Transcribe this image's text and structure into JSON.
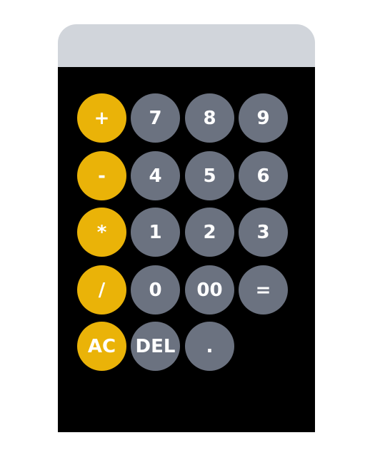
{
  "calculator": {
    "display": {
      "value": ""
    },
    "colors": {
      "display_bg": "#d1d5db",
      "keypad_bg": "#000000",
      "operator_button": "#eab308",
      "number_button": "#6b7280",
      "button_text": "#ffffff"
    },
    "rows": [
      [
        {
          "label": "+",
          "kind": "operator",
          "name": "plus-button"
        },
        {
          "label": "7",
          "kind": "number",
          "name": "seven-button"
        },
        {
          "label": "8",
          "kind": "number",
          "name": "eight-button"
        },
        {
          "label": "9",
          "kind": "number",
          "name": "nine-button"
        }
      ],
      [
        {
          "label": "-",
          "kind": "operator",
          "name": "minus-button"
        },
        {
          "label": "4",
          "kind": "number",
          "name": "four-button"
        },
        {
          "label": "5",
          "kind": "number",
          "name": "five-button"
        },
        {
          "label": "6",
          "kind": "number",
          "name": "six-button"
        }
      ],
      [
        {
          "label": "*",
          "kind": "operator",
          "name": "multiply-button"
        },
        {
          "label": "1",
          "kind": "number",
          "name": "one-button"
        },
        {
          "label": "2",
          "kind": "number",
          "name": "two-button"
        },
        {
          "label": "3",
          "kind": "number",
          "name": "three-button"
        }
      ],
      [
        {
          "label": "/",
          "kind": "operator",
          "name": "divide-button"
        },
        {
          "label": "0",
          "kind": "number",
          "name": "zero-button"
        },
        {
          "label": "00",
          "kind": "number",
          "name": "double-zero-button"
        },
        {
          "label": "=",
          "kind": "number",
          "name": "equals-button"
        }
      ],
      [
        {
          "label": "AC",
          "kind": "operator",
          "name": "all-clear-button"
        },
        {
          "label": "DEL",
          "kind": "number",
          "name": "delete-button"
        },
        {
          "label": ".",
          "kind": "number",
          "name": "decimal-point-button"
        }
      ]
    ]
  }
}
